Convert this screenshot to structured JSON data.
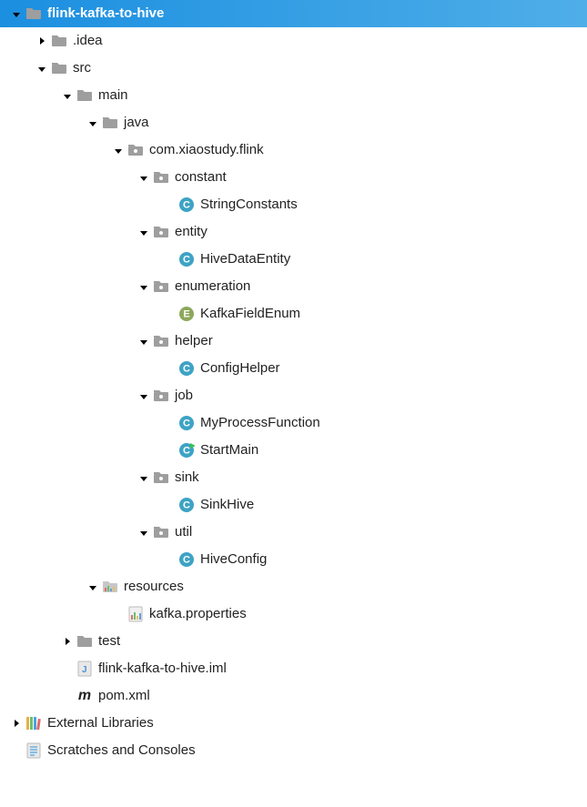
{
  "root": {
    "name": "flink-kafka-to-hive"
  },
  "idea": {
    "name": ".idea"
  },
  "src": {
    "name": "src"
  },
  "main": {
    "name": "main"
  },
  "java": {
    "name": "java"
  },
  "pkg": {
    "name": "com.xiaostudy.flink"
  },
  "constant": {
    "name": "constant"
  },
  "stringConstants": {
    "name": "StringConstants"
  },
  "entity": {
    "name": "entity"
  },
  "hiveDataEntity": {
    "name": "HiveDataEntity"
  },
  "enumeration": {
    "name": "enumeration"
  },
  "kafkaFieldEnum": {
    "name": "KafkaFieldEnum"
  },
  "helper": {
    "name": "helper"
  },
  "configHelper": {
    "name": "ConfigHelper"
  },
  "job": {
    "name": "job"
  },
  "myProcessFunction": {
    "name": "MyProcessFunction"
  },
  "startMain": {
    "name": "StartMain"
  },
  "sink": {
    "name": "sink"
  },
  "sinkHive": {
    "name": "SinkHive"
  },
  "util": {
    "name": "util"
  },
  "hiveConfig": {
    "name": "HiveConfig"
  },
  "resources": {
    "name": "resources"
  },
  "kafkaProps": {
    "name": "kafka.properties"
  },
  "test": {
    "name": "test"
  },
  "iml": {
    "name": "flink-kafka-to-hive.iml"
  },
  "pom": {
    "name": "pom.xml"
  },
  "externalLibraries": {
    "name": "External Libraries"
  },
  "scratches": {
    "name": "Scratches and Consoles"
  }
}
